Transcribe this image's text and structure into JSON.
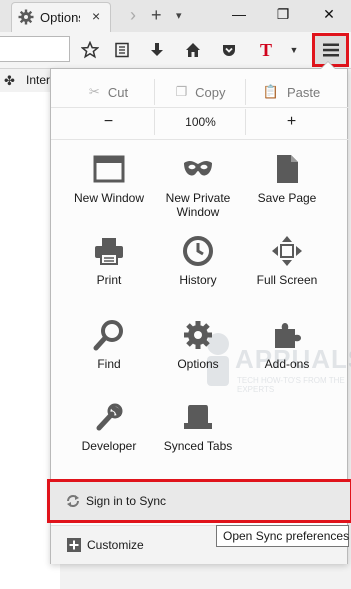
{
  "tab": {
    "title": "Options",
    "close": "×"
  },
  "tabbar": {
    "forward": "›",
    "new_tab": "+",
    "dropdown": "▾"
  },
  "window": {
    "minimize": "—",
    "restore": "❐",
    "close": "✕"
  },
  "bookmarks": {
    "label": "Internet"
  },
  "menu": {
    "edit": {
      "cut": "Cut",
      "copy": "Copy",
      "paste": "Paste"
    },
    "zoom": {
      "minus": "−",
      "value": "100%",
      "plus": "+"
    },
    "items": [
      {
        "label": "New Window",
        "icon": "window-icon"
      },
      {
        "label": "New Private Window",
        "icon": "mask-icon"
      },
      {
        "label": "Save Page",
        "icon": "document-icon"
      },
      {
        "label": "Print",
        "icon": "printer-icon"
      },
      {
        "label": "History",
        "icon": "clock-icon"
      },
      {
        "label": "Full Screen",
        "icon": "fullscreen-arrows-icon"
      },
      {
        "label": "Find",
        "icon": "magnifier-icon"
      },
      {
        "label": "Options",
        "icon": "gear-icon"
      },
      {
        "label": "Add-ons",
        "icon": "puzzle-icon"
      },
      {
        "label": "Developer",
        "icon": "wrench-icon"
      },
      {
        "label": "Synced Tabs",
        "icon": "synced-tabs-icon"
      }
    ],
    "sync": "Sign in to Sync",
    "customize": "Customize"
  },
  "tooltip": "Open Sync preferences",
  "watermark": {
    "text": "APPUALS",
    "sub": "TECH HOW-TO'S FROM THE EXPERTS"
  },
  "colors": {
    "highlight_red": "#e0131b",
    "icon_gray": "#5a5a5a",
    "toolbar_red": "#d0021b"
  }
}
